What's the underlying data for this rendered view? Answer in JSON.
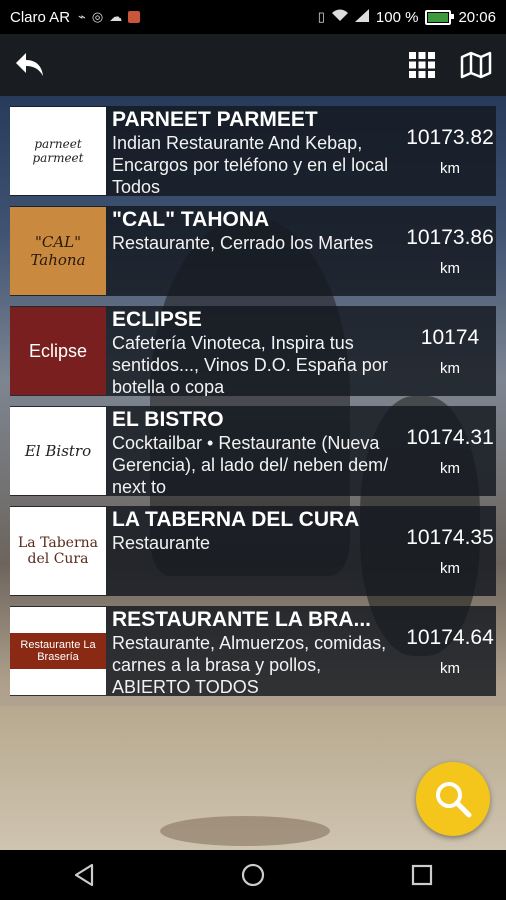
{
  "status_bar": {
    "carrier": "Claro AR",
    "battery": "100 %",
    "time": "20:06",
    "icons": [
      "usb-icon",
      "whatsapp-icon",
      "cloud-icon",
      "app-notification-icon",
      "vibrate-icon",
      "wifi-icon",
      "signal-icon",
      "battery-icon"
    ]
  },
  "app_bar": {
    "icons": [
      "back-arrow-icon",
      "grid-icon",
      "map-icon"
    ]
  },
  "places": [
    {
      "logo_text": "parneet parmeet",
      "name": "PARNEET PARMEET",
      "description": "Indian Restaurante And Kebap, Encargos por teléfono y en el local Todos",
      "distance": "10173.82",
      "unit": "km"
    },
    {
      "logo_text": "\"CAL\" Tahona",
      "name": "\"CAL\" TAHONA",
      "description": "Restaurante, Cerrado los Martes",
      "distance": "10173.86",
      "unit": "km"
    },
    {
      "logo_text": "Eclipse",
      "name": "ECLIPSE",
      "description": "Cafetería Vinoteca, Inspira tus sentidos..., Vinos D.O. España por botella o copa",
      "distance": "10174",
      "unit": "km"
    },
    {
      "logo_text": "El Bistro",
      "name": "EL BISTRO",
      "description": "Cocktailbar • Restaurante (Nueva Gerencia), al lado del/ neben dem/ next to",
      "distance": "10174.31",
      "unit": "km"
    },
    {
      "logo_text": "La Taberna del Cura",
      "name": "LA TABERNA DEL CURA",
      "description": "Restaurante",
      "distance": "10174.35",
      "unit": "km"
    },
    {
      "logo_text": "Restaurante La Brasería",
      "name": "RESTAURANTE LA BRA...",
      "description": "Restaurante, Almuerzos, comidas, carnes a la brasa y pollos, ABIERTO TODOS",
      "distance": "10174.64",
      "unit": "km"
    }
  ],
  "colors": {
    "fab": "#f4c51a",
    "card_bg": "#141820",
    "app_bar": "#191c21"
  },
  "fab_icon": "search-icon",
  "nav_icons": [
    "nav-back-icon",
    "nav-home-icon",
    "nav-recents-icon"
  ]
}
